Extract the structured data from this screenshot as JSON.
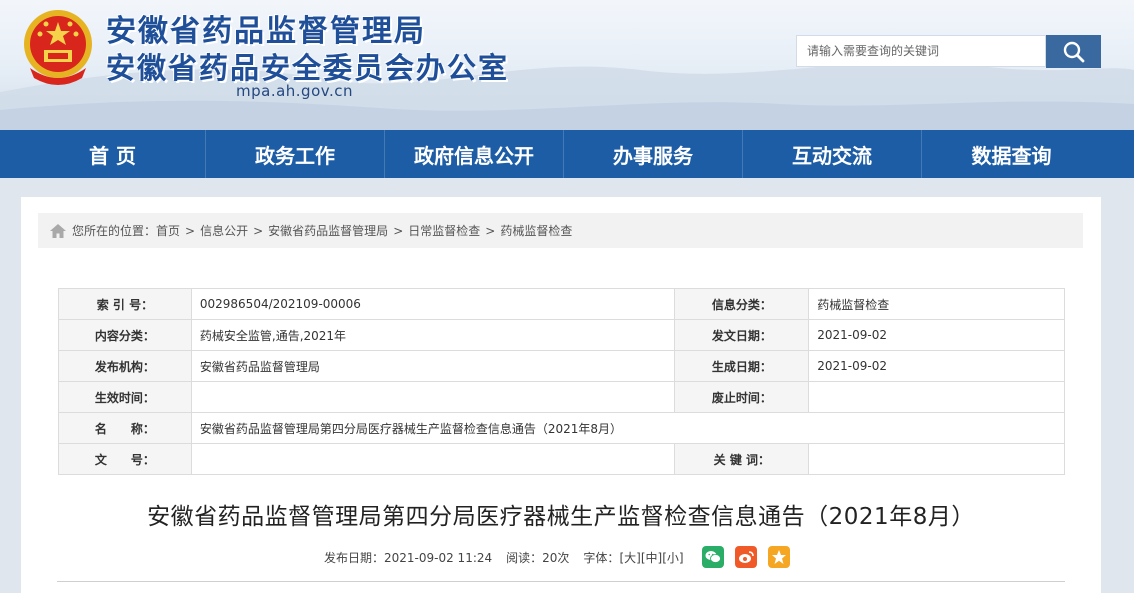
{
  "header": {
    "title_line1": "安徽省药品监督管理局",
    "title_line2": "安徽省药品安全委员会办公室",
    "domain": "mpa.ah.gov.cn",
    "emblem_icon": "national-emblem-icon"
  },
  "search": {
    "placeholder": "请输入需要查询的关键词",
    "button_icon": "search-icon"
  },
  "nav": {
    "items": [
      {
        "label": "首 页"
      },
      {
        "label": "政务工作"
      },
      {
        "label": "政府信息公开"
      },
      {
        "label": "办事服务"
      },
      {
        "label": "互动交流"
      },
      {
        "label": "数据查询"
      }
    ]
  },
  "breadcrumb": {
    "prefix": "您所在的位置：",
    "sep": ">",
    "items": [
      "首页",
      "信息公开",
      "安徽省药品监督管理局",
      "日常监督检查",
      "药械监督检查"
    ]
  },
  "info_table": {
    "index_label": "索 引 号：",
    "index_value": "002986504/202109-00006",
    "category_label": "信息分类：",
    "category_value": "药械监督检查",
    "content_cat_label": "内容分类：",
    "content_cat_value": "药械安全监管,通告,2021年",
    "issue_date_label": "发文日期：",
    "issue_date_value": "2021-09-02",
    "publisher_label": "发布机构：",
    "publisher_value": "安徽省药品监督管理局",
    "generate_date_label": "生成日期：",
    "generate_date_value": "2021-09-02",
    "effective_label": "生效时间：",
    "effective_value": "",
    "abolish_label": "废止时间：",
    "abolish_value": "",
    "name_label": "名　　称：",
    "name_value": "安徽省药品监督管理局第四分局医疗器械生产监督检查信息通告（2021年8月）",
    "doc_no_label": "文　　号：",
    "doc_no_value": "",
    "keywords_label": "关 键 词：",
    "keywords_value": ""
  },
  "article": {
    "title": "安徽省药品监督管理局第四分局医疗器械生产监督检查信息通告（2021年8月）",
    "publish_label": "发布日期：2021-09-02 11:24",
    "reads_label": "阅读：20次",
    "font_label": "字体：",
    "font_large": "[大]",
    "font_medium": "[中]",
    "font_small": "[小]"
  },
  "share": {
    "wechat_color": "#2aae67",
    "weibo_color": "#f05a28",
    "favorite_color": "#f5a623"
  },
  "colors": {
    "nav_bg": "#1d5da6",
    "title_blue": "#1f4f99"
  }
}
